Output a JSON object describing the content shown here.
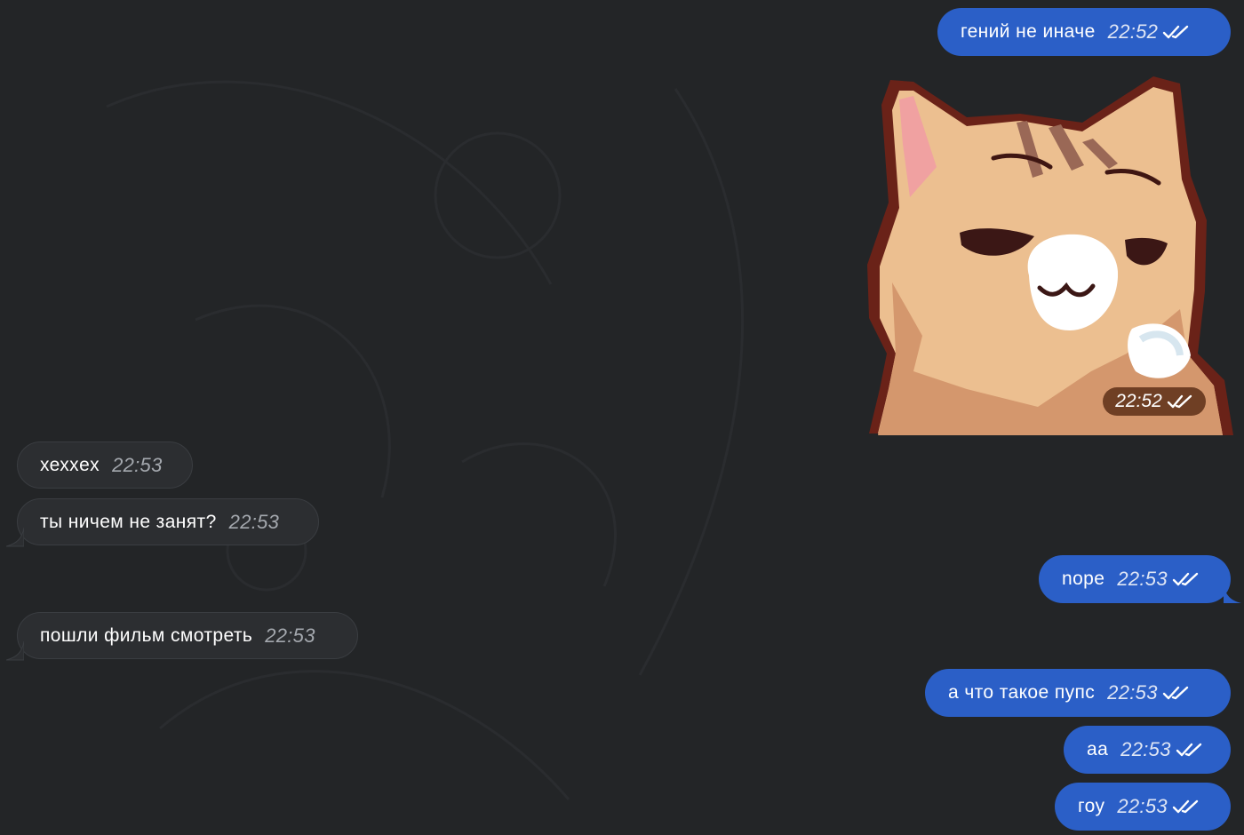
{
  "messages": [
    {
      "id": "m1",
      "text": "гений не иначе",
      "time": "22:52"
    },
    {
      "id": "m2",
      "type": "sticker",
      "time": "22:52"
    },
    {
      "id": "m3",
      "text": "хехxex",
      "time": "22:53"
    },
    {
      "id": "m4",
      "text": "ты ничем не занят?",
      "time": "22:53"
    },
    {
      "id": "m5",
      "text": "nope",
      "time": "22:53"
    },
    {
      "id": "m6",
      "text": "пошли фильм смотреть",
      "time": "22:53"
    },
    {
      "id": "m7",
      "text": "а что такое пупс",
      "time": "22:53"
    },
    {
      "id": "m8",
      "text": "аа",
      "time": "22:53"
    },
    {
      "id": "m9",
      "text": "гоу",
      "time": "22:53"
    }
  ],
  "sticker": {
    "icon": "cat-sticker-icon"
  },
  "colors": {
    "background": "#232527",
    "outgoing_bubble": "#2b5fc7",
    "incoming_bubble": "#2c2e31",
    "sticker_badge": "#6f3f24"
  }
}
